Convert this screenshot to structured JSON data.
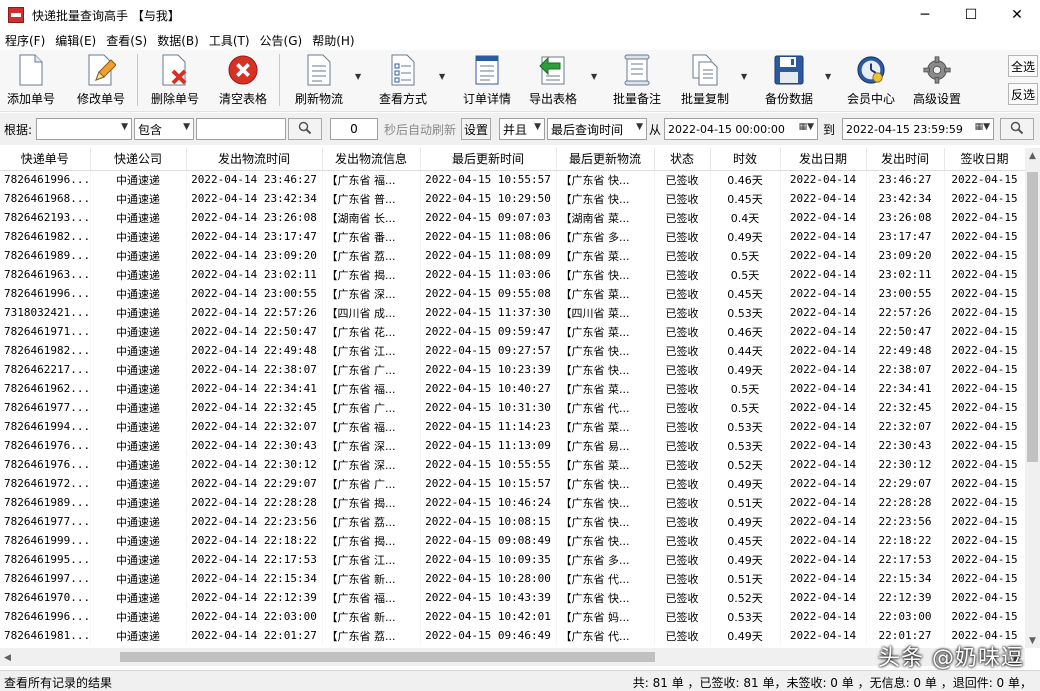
{
  "window": {
    "title": "快递批量查询高手 【与我】",
    "controls": [
      "─",
      "☐",
      "✕"
    ]
  },
  "menu": [
    "程序(F)",
    "编辑(E)",
    "查看(S)",
    "数据(B)",
    "工具(T)",
    "公告(G)",
    "帮助(H)"
  ],
  "toolbar": {
    "buttons": [
      {
        "label": "添加单号",
        "icon": "document-icon"
      },
      {
        "label": "修改单号",
        "icon": "pencil-icon"
      },
      {
        "label": "删除单号",
        "icon": "delete-document-icon"
      },
      {
        "label": "清空表格",
        "icon": "clear-circle-icon"
      },
      {
        "label": "刷新物流",
        "icon": "refresh-document-icon"
      },
      {
        "label": "查看方式",
        "icon": "view-checklist-icon"
      },
      {
        "label": "订单详情",
        "icon": "order-detail-icon"
      },
      {
        "label": "导出表格",
        "icon": "export-arrow-icon"
      },
      {
        "label": "批量备注",
        "icon": "note-scroll-icon"
      },
      {
        "label": "批量复制",
        "icon": "copy-pages-icon"
      },
      {
        "label": "备份数据",
        "icon": "floppy-disk-icon"
      },
      {
        "label": "会员中心",
        "icon": "member-clock-icon"
      },
      {
        "label": "高级设置",
        "icon": "gear-icon"
      }
    ],
    "select_all": "全选",
    "invert_select": "反选"
  },
  "filter": {
    "by_label": "根据:",
    "by_value": "",
    "match_value": "包含",
    "keyword": "",
    "refresh_seconds": "0",
    "auto_refresh_label": "秒后自动刷新",
    "settings_button": "设置",
    "logic_value": "并且",
    "time_field_value": "最后查询时间",
    "from_label": "从",
    "from_value": "2022-04-15 00:00:00",
    "to_label": "到",
    "to_value": "2022-04-15 23:59:59"
  },
  "table": {
    "columns": [
      "快递单号",
      "快递公司",
      "发出物流时间",
      "发出物流信息",
      "最后更新时间",
      "最后更新物流",
      "状态",
      "时效",
      "发出日期",
      "发出时间",
      "签收日期"
    ],
    "rows": [
      [
        "7826461996...",
        "中通速递",
        "2022-04-14 23:46:27",
        "【广东省 福...",
        "2022-04-15 10:55:57",
        "【广东省 快...",
        "已签收",
        "0.46天",
        "2022-04-14",
        "23:46:27",
        "2022-04-15"
      ],
      [
        "7826461968...",
        "中通速递",
        "2022-04-14 23:42:34",
        "【广东省 普...",
        "2022-04-15 10:29:50",
        "【广东省 快...",
        "已签收",
        "0.45天",
        "2022-04-14",
        "23:42:34",
        "2022-04-15"
      ],
      [
        "7826462193...",
        "中通速递",
        "2022-04-14 23:26:08",
        "【湖南省 长...",
        "2022-04-15 09:07:03",
        "【湖南省 菜...",
        "已签收",
        "0.4天",
        "2022-04-14",
        "23:26:08",
        "2022-04-15"
      ],
      [
        "7826461982...",
        "中通速递",
        "2022-04-14 23:17:47",
        "【广东省 番...",
        "2022-04-15 11:08:06",
        "【广东省 多...",
        "已签收",
        "0.49天",
        "2022-04-14",
        "23:17:47",
        "2022-04-15"
      ],
      [
        "7826461989...",
        "中通速递",
        "2022-04-14 23:09:20",
        "【广东省 荔...",
        "2022-04-15 11:08:09",
        "【广东省 菜...",
        "已签收",
        "0.5天",
        "2022-04-14",
        "23:09:20",
        "2022-04-15"
      ],
      [
        "7826461963...",
        "中通速递",
        "2022-04-14 23:02:11",
        "【广东省 揭...",
        "2022-04-15 11:03:06",
        "【广东省 快...",
        "已签收",
        "0.5天",
        "2022-04-14",
        "23:02:11",
        "2022-04-15"
      ],
      [
        "7826461996...",
        "中通速递",
        "2022-04-14 23:00:55",
        "【广东省 深...",
        "2022-04-15 09:55:08",
        "【广东省 菜...",
        "已签收",
        "0.45天",
        "2022-04-14",
        "23:00:55",
        "2022-04-15"
      ],
      [
        "7318032421...",
        "中通速递",
        "2022-04-14 22:57:26",
        "【四川省 成...",
        "2022-04-15 11:37:30",
        "【四川省 菜...",
        "已签收",
        "0.53天",
        "2022-04-14",
        "22:57:26",
        "2022-04-15"
      ],
      [
        "7826461971...",
        "中通速递",
        "2022-04-14 22:50:47",
        "【广东省 花...",
        "2022-04-15 09:59:47",
        "【广东省 菜...",
        "已签收",
        "0.46天",
        "2022-04-14",
        "22:50:47",
        "2022-04-15"
      ],
      [
        "7826461982...",
        "中通速递",
        "2022-04-14 22:49:48",
        "【广东省 江...",
        "2022-04-15 09:27:57",
        "【广东省 快...",
        "已签收",
        "0.44天",
        "2022-04-14",
        "22:49:48",
        "2022-04-15"
      ],
      [
        "7826462217...",
        "中通速递",
        "2022-04-14 22:38:07",
        "【广东省 广...",
        "2022-04-15 10:23:39",
        "【广东省 快...",
        "已签收",
        "0.49天",
        "2022-04-14",
        "22:38:07",
        "2022-04-15"
      ],
      [
        "7826461962...",
        "中通速递",
        "2022-04-14 22:34:41",
        "【广东省 福...",
        "2022-04-15 10:40:27",
        "【广东省 菜...",
        "已签收",
        "0.5天",
        "2022-04-14",
        "22:34:41",
        "2022-04-15"
      ],
      [
        "7826461977...",
        "中通速递",
        "2022-04-14 22:32:45",
        "【广东省 广...",
        "2022-04-15 10:31:30",
        "【广东省 代...",
        "已签收",
        "0.5天",
        "2022-04-14",
        "22:32:45",
        "2022-04-15"
      ],
      [
        "7826461994...",
        "中通速递",
        "2022-04-14 22:32:07",
        "【广东省 福...",
        "2022-04-15 11:14:23",
        "【广东省 菜...",
        "已签收",
        "0.53天",
        "2022-04-14",
        "22:32:07",
        "2022-04-15"
      ],
      [
        "7826461976...",
        "中通速递",
        "2022-04-14 22:30:43",
        "【广东省 深...",
        "2022-04-15 11:13:09",
        "【广东省 易...",
        "已签收",
        "0.53天",
        "2022-04-14",
        "22:30:43",
        "2022-04-15"
      ],
      [
        "7826461976...",
        "中通速递",
        "2022-04-14 22:30:12",
        "【广东省 深...",
        "2022-04-15 10:55:55",
        "【广东省 菜...",
        "已签收",
        "0.52天",
        "2022-04-14",
        "22:30:12",
        "2022-04-15"
      ],
      [
        "7826461972...",
        "中通速递",
        "2022-04-14 22:29:07",
        "【广东省 广...",
        "2022-04-15 10:15:57",
        "【广东省 快...",
        "已签收",
        "0.49天",
        "2022-04-14",
        "22:29:07",
        "2022-04-15"
      ],
      [
        "7826461989...",
        "中通速递",
        "2022-04-14 22:28:28",
        "【广东省 揭...",
        "2022-04-15 10:46:24",
        "【广东省 快...",
        "已签收",
        "0.51天",
        "2022-04-14",
        "22:28:28",
        "2022-04-15"
      ],
      [
        "7826461977...",
        "中通速递",
        "2022-04-14 22:23:56",
        "【广东省 荔...",
        "2022-04-15 10:08:15",
        "【广东省 快...",
        "已签收",
        "0.49天",
        "2022-04-14",
        "22:23:56",
        "2022-04-15"
      ],
      [
        "7826461999...",
        "中通速递",
        "2022-04-14 22:18:22",
        "【广东省 揭...",
        "2022-04-15 09:08:49",
        "【广东省 快...",
        "已签收",
        "0.45天",
        "2022-04-14",
        "22:18:22",
        "2022-04-15"
      ],
      [
        "7826461995...",
        "中通速递",
        "2022-04-14 22:17:53",
        "【广东省 江...",
        "2022-04-15 10:09:35",
        "【广东省 多...",
        "已签收",
        "0.49天",
        "2022-04-14",
        "22:17:53",
        "2022-04-15"
      ],
      [
        "7826461997...",
        "中通速递",
        "2022-04-14 22:15:34",
        "【广东省 新...",
        "2022-04-15 10:28:00",
        "【广东省 代...",
        "已签收",
        "0.51天",
        "2022-04-14",
        "22:15:34",
        "2022-04-15"
      ],
      [
        "7826461970...",
        "中通速递",
        "2022-04-14 22:12:39",
        "【广东省 福...",
        "2022-04-15 10:43:39",
        "【广东省 快...",
        "已签收",
        "0.52天",
        "2022-04-14",
        "22:12:39",
        "2022-04-15"
      ],
      [
        "7826461996...",
        "中通速递",
        "2022-04-14 22:03:00",
        "【广东省 新...",
        "2022-04-15 10:42:01",
        "【广东省 妈...",
        "已签收",
        "0.53天",
        "2022-04-14",
        "22:03:00",
        "2022-04-15"
      ],
      [
        "7826461981...",
        "中通速递",
        "2022-04-14 22:01:27",
        "【广东省 荔...",
        "2022-04-15 09:46:49",
        "【广东省 代...",
        "已签收",
        "0.49天",
        "2022-04-14",
        "22:01:27",
        "2022-04-15"
      ]
    ]
  },
  "status": {
    "left": "查看所有记录的结果",
    "right": "共: 81 单 ，已签收: 81 单，未签收: 0 单 ，无信息: 0 单 ，退回件: 0 单，"
  },
  "watermark": "头条 @奶味逗",
  "colors": {
    "delete_red": "#d93025",
    "export_green": "#2e9e3a",
    "save_blue": "#2c5aa0"
  }
}
